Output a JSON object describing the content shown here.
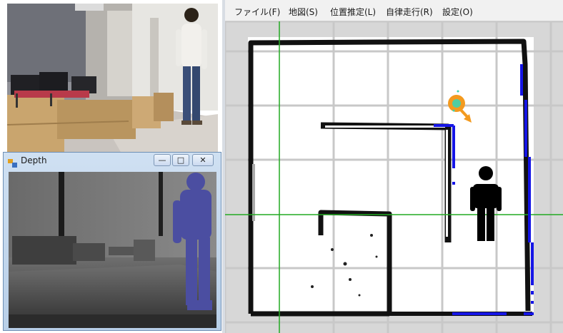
{
  "depth_window": {
    "title": "Depth",
    "buttons": {
      "minimize": "—",
      "maximize": "□",
      "close": "✕"
    }
  },
  "map_app": {
    "menu": [
      {
        "label": "ファイル(F)"
      },
      {
        "label": "地図(S)"
      },
      {
        "label": "位置推定(L)"
      },
      {
        "label": "自律走行(R)"
      },
      {
        "label": "設定(O)"
      }
    ]
  },
  "colors": {
    "map_free": "#ffffff",
    "map_wall": "#111111",
    "map_unknown": "#d7d7d7",
    "grid": "#c8c8c8",
    "axis": "#22aa22",
    "laser_points": "#1515e6",
    "robot": "#f39a1f",
    "robot_particles": "#3dd3b0",
    "person": "#000000",
    "depth_person": "#4b4ea1"
  },
  "icons": [
    "app-icon",
    "minimize-icon",
    "maximize-icon",
    "close-icon",
    "robot-marker-icon",
    "person-icon"
  ]
}
